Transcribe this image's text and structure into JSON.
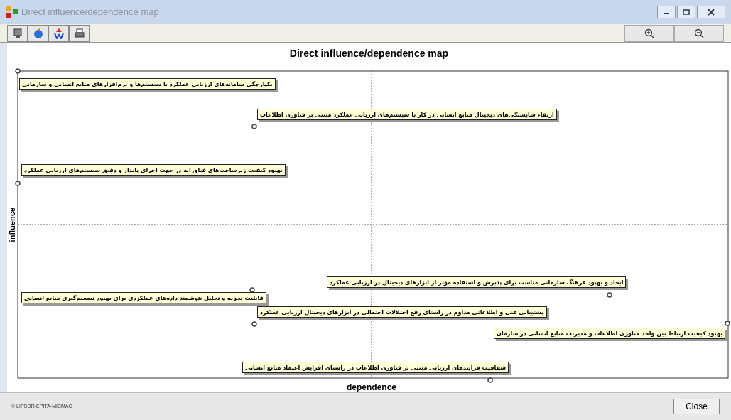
{
  "window": {
    "title": "Direct influence/dependence map"
  },
  "map": {
    "title": "Direct influence/dependence map",
    "xlabel": "dependence",
    "ylabel": "influence",
    "variables": [
      {
        "label": "یکپارچگی سامانه‌های ارزیابی عملکرد با سیستم‌ها و نرم‌افزارهای منابع انسانی و سازمانی"
      },
      {
        "label": "ارتقاء شایستگی‌های دیجیتال منابع انسانی در کار با سیستم‌های ارزیابی عملکرد مبتنی بر فناوری اطلاعات"
      },
      {
        "label": "بهبود کیفیت زیرساخت‌های فناورانه در جهت اجرای پایدار و دقیق سیستم‌های ارزیابی عملکرد"
      },
      {
        "label": "ایجاد و بهبود فرهنگ سازمانی مناسب برای پذیرش و استفاده مؤثر از ابزارهای دیجیتال در ارزیابی عملکرد"
      },
      {
        "label": "قابلیت تجزیه و تحلیل هوشمند داده‌های عملکردی برای بهبود تصمیم‌گیری منابع انسانی"
      },
      {
        "label": "پشتیبانی فنی و اطلاعاتی مداوم در راستای رفع اختلالات احتمالی در ابزارهای دیجیتال ارزیابی عملکرد"
      },
      {
        "label": "بهبود کیفیت ارتباط بین واحد فناوری اطلاعات و مدیریت منابع انسانی در سازمان"
      },
      {
        "label": "شفافیت فرآیندهای ارزیابی مبتنی بر فناوری اطلاعات در راستای افزایش اعتماد منابع انسانی"
      }
    ]
  },
  "footer": {
    "copyright": "© LIPSOR-EPITA-MICMAC"
  },
  "close_button": {
    "label": "Close"
  }
}
